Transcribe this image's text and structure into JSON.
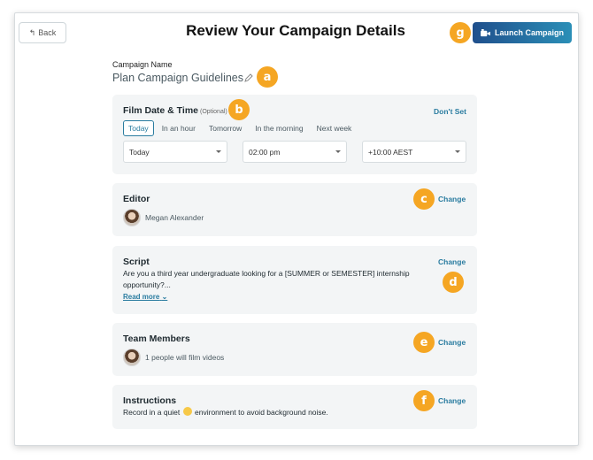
{
  "header": {
    "back_label": "Back",
    "title": "Review Your Campaign Details",
    "launch_label": "Launch Campaign"
  },
  "badges": {
    "a": "a",
    "b": "b",
    "c": "c",
    "d": "d",
    "e": "e",
    "f": "f",
    "g": "g"
  },
  "campaign": {
    "label": "Campaign Name",
    "name": "Plan Campaign Guidelines"
  },
  "film_date": {
    "title": "Film Date & Time",
    "optional": "(Optional)",
    "dont_set": "Don't Set",
    "quick_options": [
      "Today",
      "In an hour",
      "Tomorrow",
      "In the morning",
      "Next week"
    ],
    "selected_option": "Today",
    "date_value": "Today",
    "time_value": "02:00 pm",
    "timezone_value": "+10:00 AEST"
  },
  "editor": {
    "title": "Editor",
    "change": "Change",
    "name": "Megan Alexander"
  },
  "script": {
    "title": "Script",
    "change": "Change",
    "text_line1": "Are you a third year undergraduate looking for a [SUMMER or SEMESTER] internship",
    "text_line2": "opportunity?...",
    "read_more": "Read more"
  },
  "team": {
    "title": "Team Members",
    "change": "Change",
    "summary": "1 people will film videos"
  },
  "instructions": {
    "title": "Instructions",
    "change": "Change",
    "text_before": "Record in a quiet",
    "text_after": "environment to avoid background noise."
  },
  "colors": {
    "accent": "#2a7ca0",
    "badge": "#f5a623",
    "launch_start": "#1f4f8c",
    "launch_end": "#2b8fb7"
  }
}
